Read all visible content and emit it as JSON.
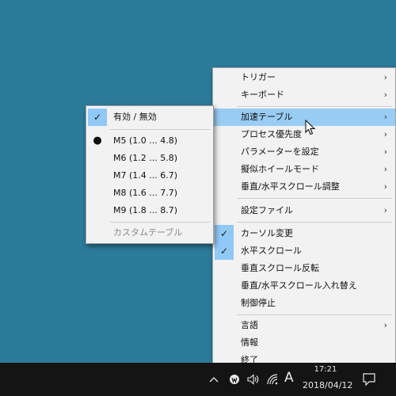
{
  "main_menu": {
    "items": [
      {
        "label": "トリガー",
        "submenu": true
      },
      {
        "label": "キーボード",
        "submenu": true
      },
      {
        "label": "加速テーブル",
        "submenu": true
      },
      {
        "label": "プロセス優先度",
        "submenu": true
      },
      {
        "label": "パラメーターを設定",
        "submenu": true
      },
      {
        "label": "擬似ホイールモード",
        "submenu": true
      },
      {
        "label": "垂直/水平スクロール調整",
        "submenu": true
      },
      {
        "label": "設定ファイル",
        "submenu": true
      },
      {
        "label": "カーソル変更",
        "checked": true
      },
      {
        "label": "水平スクロール",
        "checked": true
      },
      {
        "label": "垂直スクロール反転"
      },
      {
        "label": "垂直/水平スクロール入れ替え"
      },
      {
        "label": "制御停止"
      },
      {
        "label": "言語",
        "submenu": true
      },
      {
        "label": "情報"
      },
      {
        "label": "終了"
      }
    ],
    "arrow": "›"
  },
  "sub_menu": {
    "enabled": {
      "label": "有効 / 無効",
      "checked": true
    },
    "options": [
      {
        "label": "M5 (1.0 ... 4.8)",
        "selected": true
      },
      {
        "label": "M6 (1.2 ... 5.8)"
      },
      {
        "label": "M7 (1.4 ... 6.7)"
      },
      {
        "label": "M8 (1.6 ... 7.7)"
      },
      {
        "label": "M9 (1.8 ... 8.7)"
      }
    ],
    "custom": {
      "label": "カスタムテーブル",
      "disabled": true
    }
  },
  "marks": {
    "check": "✓",
    "dot": "●"
  },
  "taskbar": {
    "ime_indicator": "A",
    "time": "17:21",
    "date": "2018/04/12",
    "icons": [
      "chevron-up-icon",
      "app-tray-icon",
      "volume-icon",
      "wifi-icon",
      "ime-icon",
      "notification-icon"
    ]
  },
  "colors": {
    "desktop": "#2b7a99",
    "highlight": "#99ccf3",
    "check_bg": "#90c8f6",
    "taskbar": "#141414"
  }
}
